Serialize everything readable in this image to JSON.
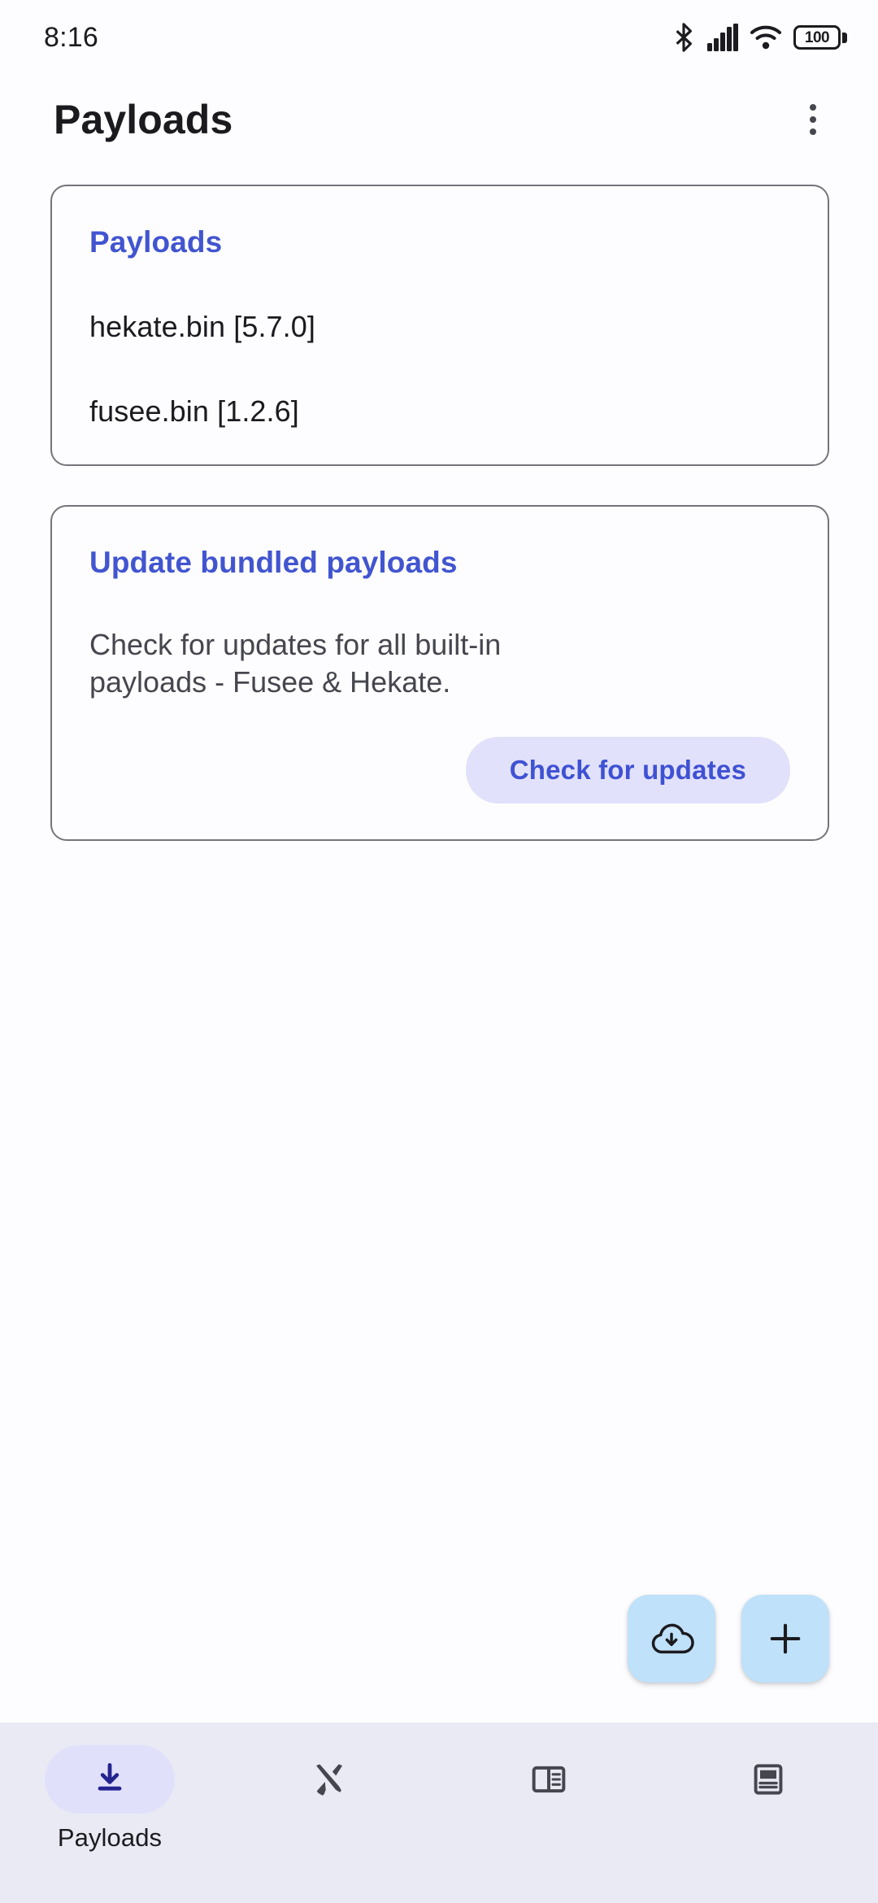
{
  "statusbar": {
    "time": "8:16",
    "icons": [
      "bluetooth-icon",
      "cellular-signal-icon",
      "wifi-icon",
      "battery-icon"
    ],
    "battery_level": "100"
  },
  "appbar": {
    "title": "Payloads",
    "overflow_menu": "more-options-icon"
  },
  "cards": {
    "payloads": {
      "title": "Payloads",
      "items": [
        "hekate.bin [5.7.0]",
        "fusee.bin [1.2.6]"
      ]
    },
    "update": {
      "title": "Update bundled payloads",
      "body": "Check for updates for all built-in payloads - Fusee & Hekate.",
      "button_label": "Check for updates"
    }
  },
  "fabs": [
    {
      "name": "cloud-download-fab",
      "icon": "cloud-download-icon"
    },
    {
      "name": "add-fab",
      "icon": "plus-icon"
    }
  ],
  "bottomnav": {
    "items": [
      {
        "label": "Payloads",
        "icon": "download-icon",
        "active": true
      },
      {
        "label": "",
        "icon": "tools-icon",
        "active": false
      },
      {
        "label": "",
        "icon": "split-view-icon",
        "active": false
      },
      {
        "label": "",
        "icon": "document-icon",
        "active": false
      }
    ]
  },
  "colors": {
    "accent": "#4255d0",
    "tonal_button_bg": "#e2e1fb",
    "fab_bg": "#bfe1fa",
    "nav_bg": "#eaeaf4",
    "nav_active_pill": "#e1e0fb"
  }
}
